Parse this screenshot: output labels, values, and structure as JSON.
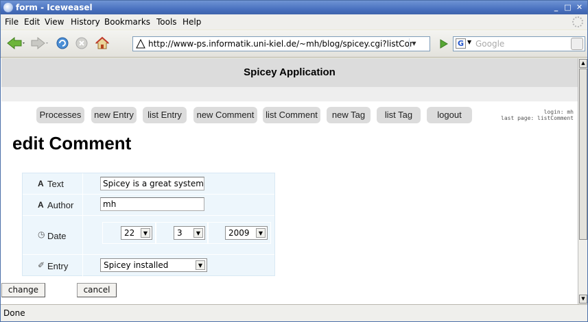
{
  "window": {
    "title": "form - Iceweasel"
  },
  "menu": {
    "items": [
      "File",
      "Edit",
      "View",
      "History",
      "Bookmarks",
      "Tools",
      "Help"
    ]
  },
  "navbar": {
    "url": "http://www-ps.informatik.uni-kiel.de/~mh/blog/spicey.cgi?listComme",
    "search_placeholder": "Google",
    "icons": [
      "back-icon",
      "forward-icon",
      "reload-icon",
      "stop-icon",
      "home-icon"
    ]
  },
  "page": {
    "app_title": "Spicey Application",
    "nav": [
      "Processes",
      "new Entry",
      "list Entry",
      "new Comment",
      "list Comment",
      "new Tag",
      "list Tag",
      "logout"
    ],
    "login_line": "login: mh",
    "lastpage_line": "last page: listComment",
    "heading": "edit Comment",
    "form": {
      "text_label": "Text",
      "text_value": "Spicey is a great system",
      "author_label": "Author",
      "author_value": "mh",
      "date_label": "Date",
      "day": "22",
      "month": "3",
      "year": "2009",
      "entry_label": "Entry",
      "entry_value": "Spicey installed"
    },
    "buttons": {
      "change": "change",
      "cancel": "cancel"
    }
  },
  "status": {
    "text": "Done"
  },
  "colors": {
    "titlebar": "#4a72c0",
    "form_bg": "#edf6fc",
    "header_bg": "#dcdcdc",
    "nav_btn": "#dcdcdc"
  }
}
